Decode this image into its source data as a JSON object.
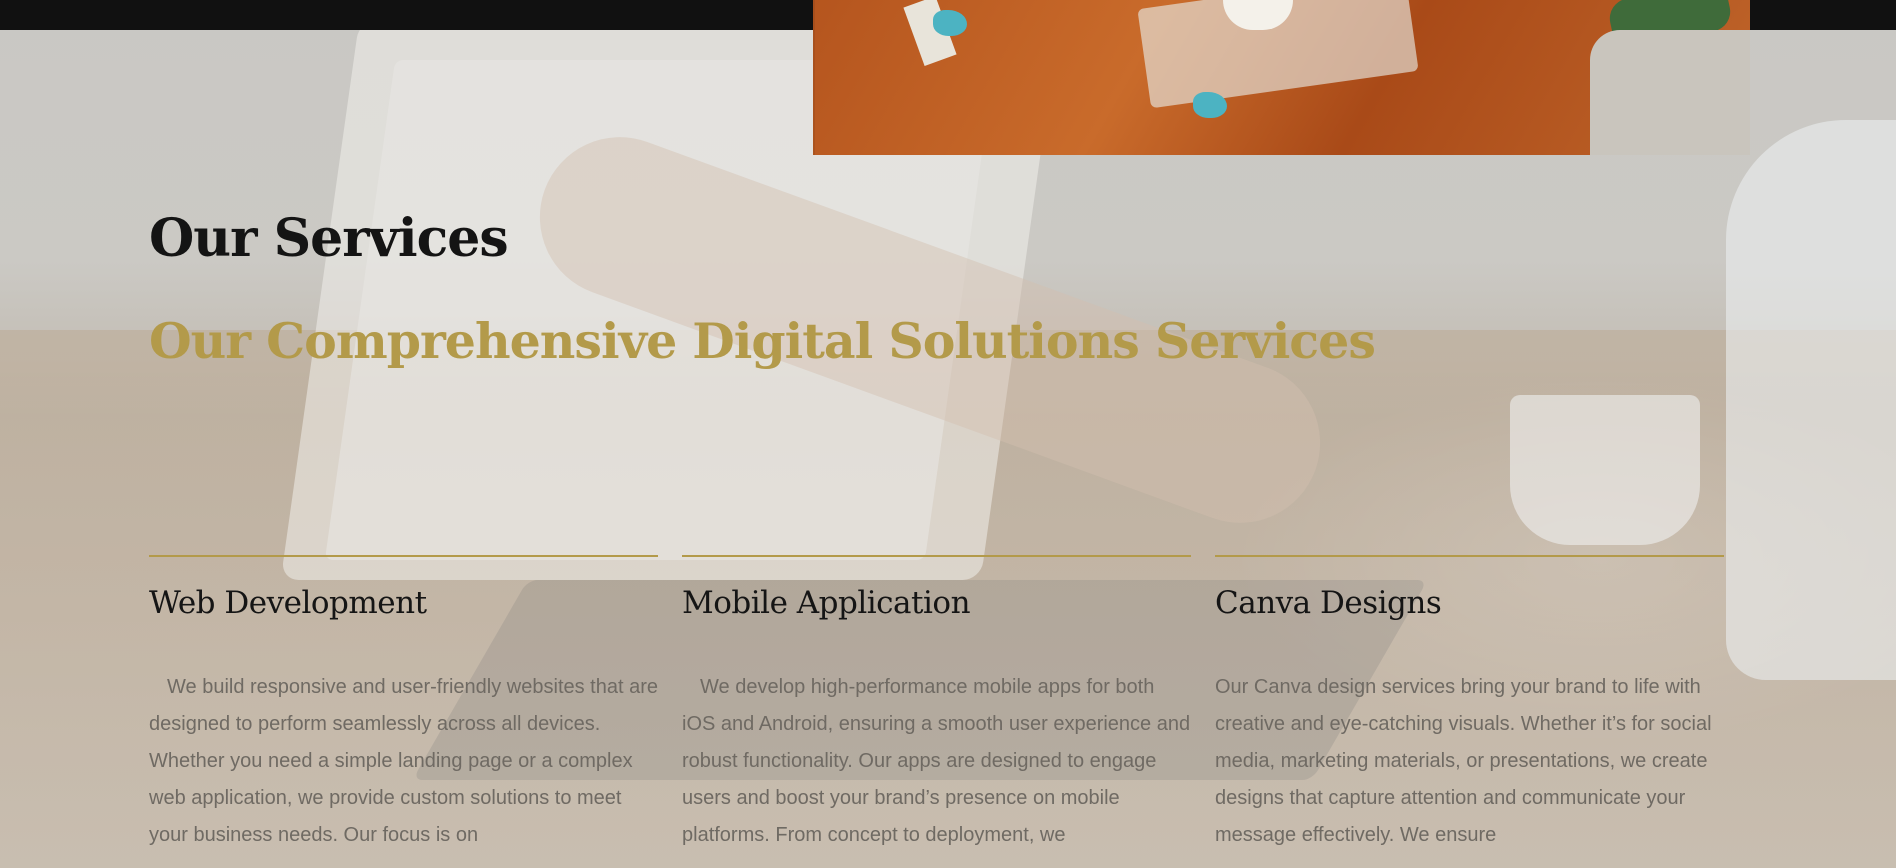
{
  "section": {
    "title": "Our Services",
    "subtitle": "Our Comprehensive Digital Solutions Services"
  },
  "services": [
    {
      "title": "Web Development",
      "description": "We build responsive and user-friendly websites that are designed to perform seamlessly across all devices. Whether you need a simple landing page or a complex web application, we provide custom solutions to meet your business needs. Our focus is on"
    },
    {
      "title": "Mobile Application",
      "description": "We develop high-performance mobile apps for both iOS and Android, ensuring a smooth user experience and robust functionality. Our apps are designed to engage users and boost your brand’s presence on mobile platforms. From concept to deployment, we"
    },
    {
      "title": "Canva Designs",
      "description": "Our Canva design services bring your brand to life with creative and eye-catching visuals. Whether it’s for social media, marketing materials, or presentations, we create designs that capture attention and communicate your message effectively. We ensure"
    }
  ],
  "colors": {
    "accent": "#b39a4a",
    "heading": "#141414",
    "body_text": "#6f6a63",
    "top_bar": "#111111"
  }
}
